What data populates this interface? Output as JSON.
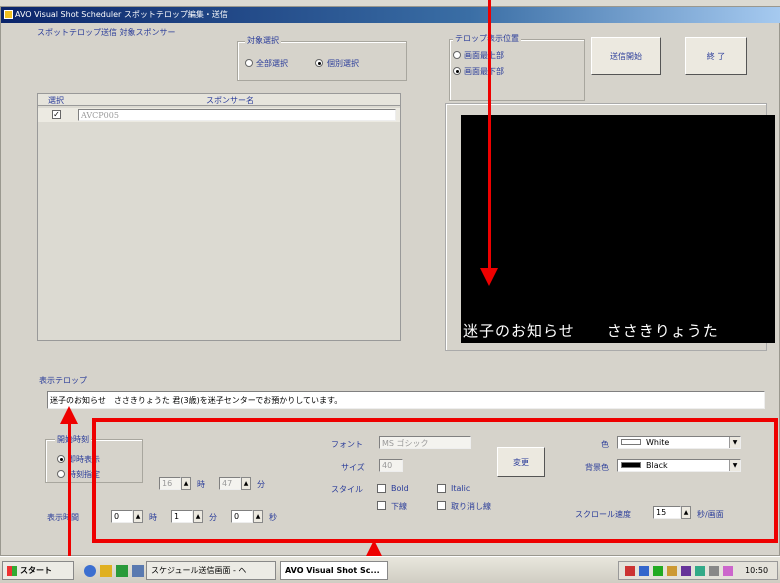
{
  "window": {
    "title": "AVO Visual Shot Scheduler  スポットテロップ編集・送信"
  },
  "sponsor": {
    "section_label": "スポットテロップ送信 対象スポンサー",
    "target_group_label": "対象選択",
    "all_label": "全部選択",
    "individual_label": "個別選択",
    "selected": "個別選択",
    "table_headers": [
      "選択",
      "スポンサー名"
    ],
    "rows": [
      {
        "checked": true,
        "name": "AVCP005"
      }
    ]
  },
  "position": {
    "group_label": "テロップ表示位置",
    "top_label": "画面最上部",
    "bottom_label": "画面最下部",
    "selected": "画面最下部"
  },
  "actions": {
    "send_label": "送信開始",
    "end_label": "終 了"
  },
  "preview": {
    "text": "迷子のお知らせ　　ささきりょうた"
  },
  "telop": {
    "label": "表示テロップ",
    "value": "迷子のお知らせ　ささきりょうた 君(3歳)を迷子センターでお預かりしています。"
  },
  "timing": {
    "start_group_label": "開始時刻",
    "immediate_label": "即時表示",
    "scheduled_label": "時刻指定",
    "selected": "即時表示",
    "hour_value": "16",
    "hour_unit": "時",
    "minute_value": "47",
    "minute_unit": "分",
    "duration_label": "表示時間",
    "dur_hour_value": "0",
    "dur_hour_unit": "時",
    "dur_min_value": "1",
    "dur_min_unit": "分",
    "dur_sec_value": "0",
    "dur_sec_unit": "秒"
  },
  "font": {
    "font_label": "フォント",
    "font_value": "MS ゴシック",
    "size_label": "サイズ",
    "size_value": "40",
    "style_label": "スタイル",
    "bold_label": "Bold",
    "italic_label": "Italic",
    "underline_label": "下線",
    "strike_label": "取り消し線",
    "change_label": "変更"
  },
  "colors": {
    "color_label": "色",
    "color_value": "White",
    "bg_label": "背景色",
    "bg_value": "Black",
    "scroll_label": "スクロール速度",
    "scroll_value": "15",
    "scroll_unit": "秒/画面"
  },
  "taskbar": {
    "start_label": "スタート",
    "items": [
      "スケジュール送信画面 - ヘ",
      "AVO Visual Shot Sc..."
    ],
    "clock": "10:50"
  },
  "theme": {
    "label_color": "#2a3c9a",
    "highlight_color": "#ee0000"
  }
}
